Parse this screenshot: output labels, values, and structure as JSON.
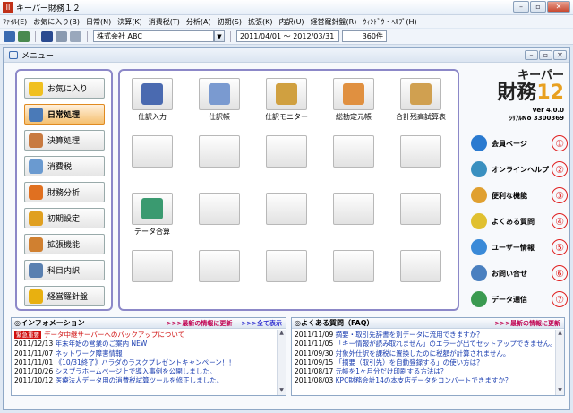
{
  "titlebar": {
    "app_icon": "II",
    "title": "キーパー財務１２"
  },
  "menu": [
    "ﾌｧｲﾙ(E)",
    "お気に入り(B)",
    "日常(N)",
    "決算(K)",
    "消費税(T)",
    "分析(A)",
    "初期(S)",
    "拡張(K)",
    "内訳(U)",
    "経営羅針盤(R)",
    "ｳｨﾝﾄﾞｳ・ﾍﾙﾌﾟ(H)"
  ],
  "toolbar": {
    "company": "株式会社 ABC",
    "period": "2011/04/01 ～ 2012/03/31",
    "count": "360件"
  },
  "subwindow": {
    "title": "メニュー"
  },
  "nav": [
    {
      "label": "お気に入り",
      "color": "#f0c020"
    },
    {
      "label": "日常処理",
      "color": "#4a7ab8",
      "active": true
    },
    {
      "label": "決算処理",
      "color": "#c87a40"
    },
    {
      "label": "消費税",
      "color": "#6a9ad0"
    },
    {
      "label": "財務分析",
      "color": "#e07020"
    },
    {
      "label": "初期設定",
      "color": "#e0a020"
    },
    {
      "label": "拡張機能",
      "color": "#d08030"
    },
    {
      "label": "科目内訳",
      "color": "#5a80b0"
    },
    {
      "label": "経営羅針盤",
      "color": "#e8b010"
    }
  ],
  "grid": [
    {
      "label": "仕訳入力",
      "color": "#4a6ab0"
    },
    {
      "label": "仕訳帳",
      "color": "#7a9ad0"
    },
    {
      "label": "仕訳モニター",
      "color": "#d0a040"
    },
    {
      "label": "総勘定元帳",
      "color": "#e09040"
    },
    {
      "label": "合計残高試算表",
      "color": "#d0a050"
    },
    {
      "label": "",
      "color": ""
    },
    {
      "label": "",
      "color": ""
    },
    {
      "label": "",
      "color": ""
    },
    {
      "label": "",
      "color": ""
    },
    {
      "label": "",
      "color": ""
    },
    {
      "label": "データ合算",
      "color": "#3a9a70"
    },
    {
      "label": "",
      "color": ""
    },
    {
      "label": "",
      "color": ""
    },
    {
      "label": "",
      "color": ""
    },
    {
      "label": "",
      "color": ""
    },
    {
      "label": "",
      "color": ""
    },
    {
      "label": "",
      "color": ""
    },
    {
      "label": "",
      "color": ""
    },
    {
      "label": "",
      "color": ""
    },
    {
      "label": "",
      "color": ""
    }
  ],
  "logo": {
    "line1": "キーパー",
    "line2a": "財務",
    "line2b": "12",
    "version": "Ver 4.0.0",
    "serial": "ｼﾘｱﾙNo 3300369"
  },
  "side": [
    {
      "label": "会員ページ",
      "num": "①",
      "color": "#2a7ad0"
    },
    {
      "label": "オンラインヘルプ",
      "num": "②",
      "color": "#3a90c0"
    },
    {
      "label": "便利な機能",
      "num": "③",
      "color": "#e0a030"
    },
    {
      "label": "よくある質問",
      "num": "④",
      "color": "#e0c030"
    },
    {
      "label": "ユーザー情報",
      "num": "⑤",
      "color": "#3a8ad8"
    },
    {
      "label": "お問い合せ",
      "num": "⑥",
      "color": "#4a80c0"
    },
    {
      "label": "データ通信",
      "num": "⑦",
      "color": "#3a9a50"
    }
  ],
  "info": {
    "title": "◎インフォメーション",
    "link1": ">>>最新の情報に更新",
    "link2": ">>>全て表示",
    "badge": "緊急重要",
    "rows": [
      {
        "date": "",
        "text": "データ中継サーバーへのバックアップについて",
        "red": true,
        "badge": true
      },
      {
        "date": "2011/12/13",
        "text": "年末年始の営業のご案内 NEW"
      },
      {
        "date": "2011/11/07",
        "text": "ネットワーク障害情報"
      },
      {
        "date": "2011/11/01",
        "text": "《10/31終了》ハラダのラスクプレゼントキャンペーン！！"
      },
      {
        "date": "2011/10/26",
        "text": "シスプラホームページ上で導入事例を公開しました。"
      },
      {
        "date": "2011/10/12",
        "text": "医療法人データ用の消費税試算ツールを修正しました。"
      }
    ]
  },
  "faq": {
    "title": "◎よくある質問（FAQ）",
    "link1": ">>>最新の情報に更新",
    "rows": [
      {
        "date": "2011/11/09",
        "text": "摘要・取引先辞書を別データに流用できますか？"
      },
      {
        "date": "2011/11/05",
        "text": "「キー情報が読み取れません」のエラーが出てセットアップできません。"
      },
      {
        "date": "2011/09/30",
        "text": "対象外仕訳を課税に置換したのに税額が計算されません。"
      },
      {
        "date": "2011/09/15",
        "text": "「摘要（取引先）を自動登録する」の使い方は？"
      },
      {
        "date": "2011/08/17",
        "text": "元帳を1ヶ月分だけ印刷する方法は？"
      },
      {
        "date": "2011/08/03",
        "text": "KPC財務会計14の本支店データをコンバートできますか？"
      }
    ]
  }
}
